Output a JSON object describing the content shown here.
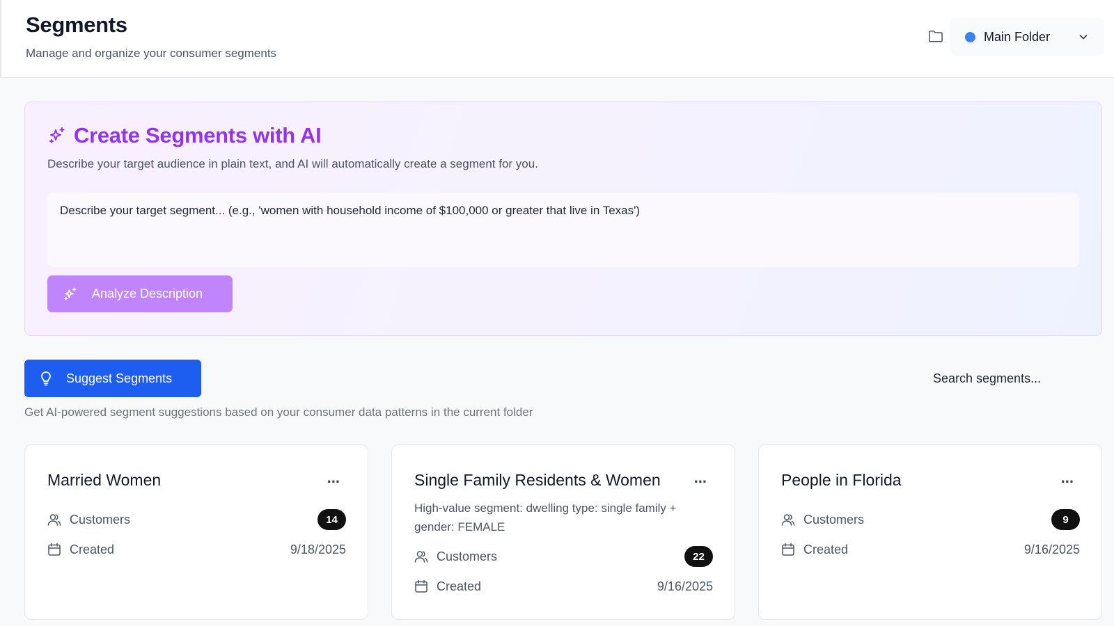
{
  "header": {
    "title": "Segments",
    "subtitle": "Manage and organize your consumer segments",
    "folder_selector": {
      "label": "Main Folder",
      "dot_color": "#3b82f6"
    }
  },
  "ai_panel": {
    "title": "Create Segments with AI",
    "description": "Describe your target audience in plain text, and AI will automatically create a segment for you.",
    "input_placeholder": "Describe your target segment... (e.g., 'women with household income of $100,000 or greater that live in Texas')",
    "analyze_label": "Analyze Description",
    "accent_color": "#9333ea"
  },
  "suggest": {
    "button_label": "Suggest Segments",
    "hint": "Get AI-powered segment suggestions based on your consumer data patterns in the current folder",
    "primary_color": "#1d5ef0"
  },
  "search": {
    "placeholder": "Search segments..."
  },
  "cards": [
    {
      "title": "Married Women",
      "description": "",
      "customers_label": "Customers",
      "customers_count": "14",
      "created_label": "Created",
      "created_date": "9/18/2025",
      "menu": "..."
    },
    {
      "title": "Single Family Residents & Women",
      "description": "High-value segment: dwelling type: single family + gender: FEMALE",
      "customers_label": "Customers",
      "customers_count": "22",
      "created_label": "Created",
      "created_date": "9/16/2025",
      "menu": "..."
    },
    {
      "title": "People in Florida",
      "description": "",
      "customers_label": "Customers",
      "customers_count": "9",
      "created_label": "Created",
      "created_date": "9/16/2025",
      "menu": "..."
    }
  ]
}
